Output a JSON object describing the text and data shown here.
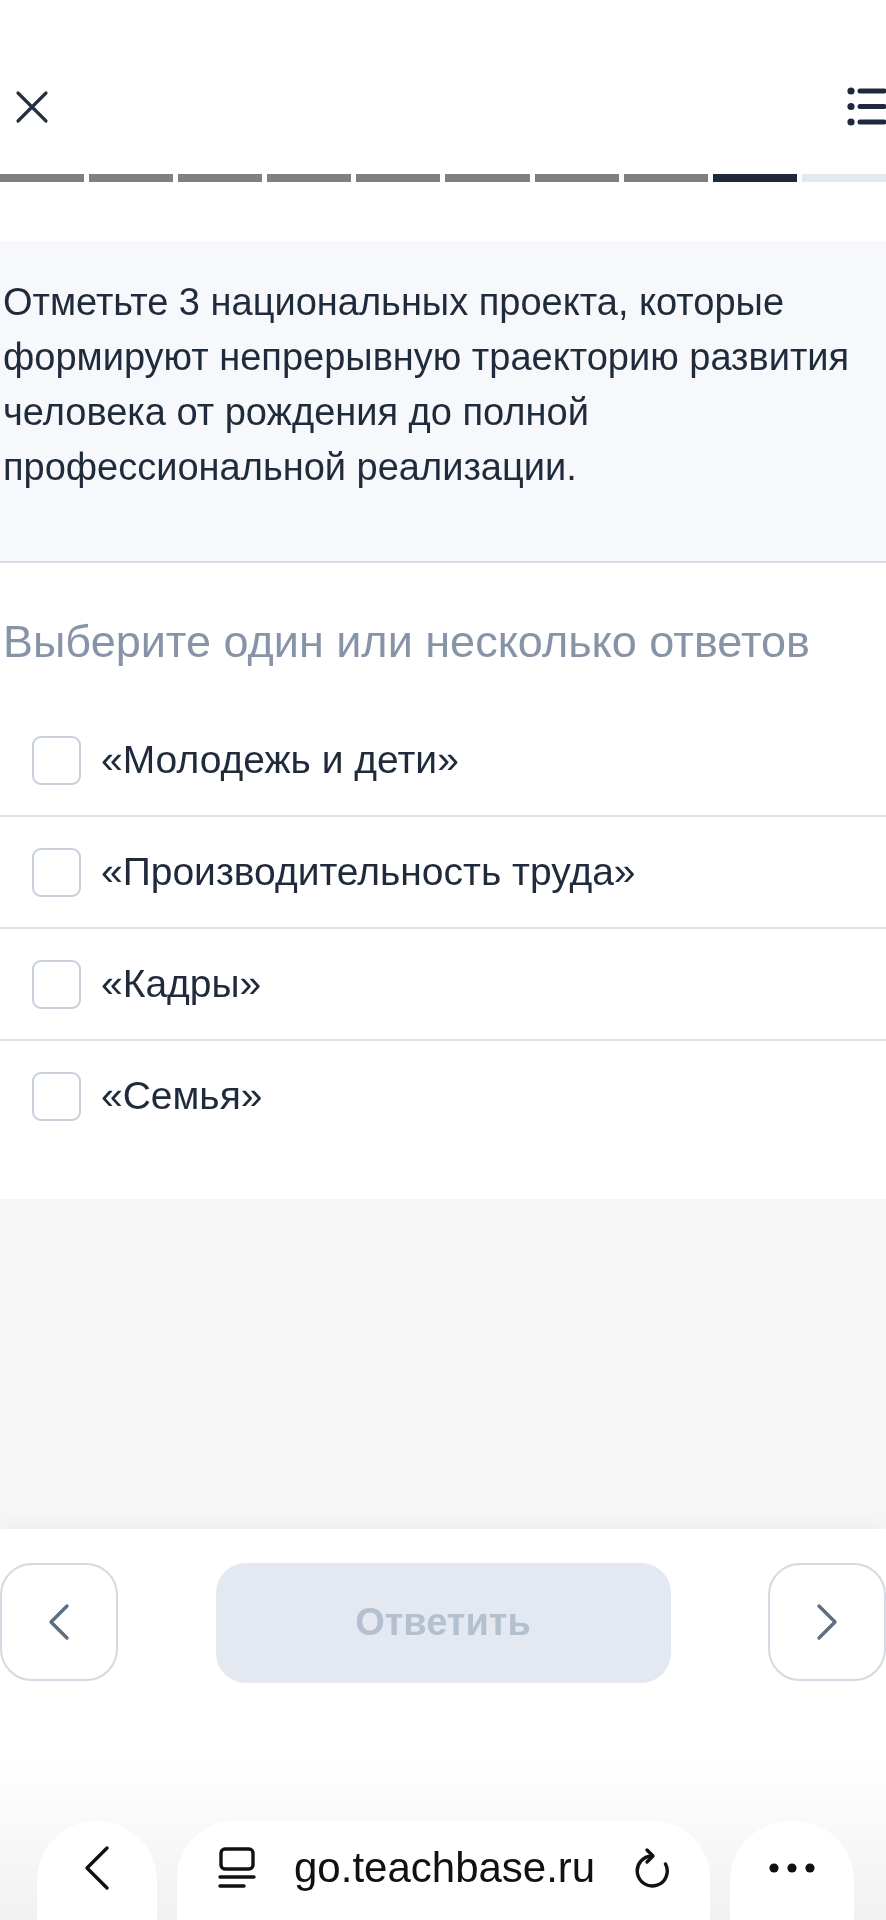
{
  "header": {
    "progress": [
      {
        "completed": true,
        "selected": false
      },
      {
        "completed": true,
        "selected": false
      },
      {
        "completed": true,
        "selected": false
      },
      {
        "completed": true,
        "selected": false
      },
      {
        "completed": true,
        "selected": false
      },
      {
        "completed": true,
        "selected": false
      },
      {
        "completed": true,
        "selected": false
      },
      {
        "completed": true,
        "selected": false
      },
      {
        "completed": false,
        "selected": true
      },
      {
        "completed": false,
        "selected": false
      }
    ]
  },
  "question": {
    "text": "Отметьте 3 национальных проекта, которые формируют непрерывную траекторию развития человека от рождения до полной профессиональной реализации."
  },
  "instruction": "Выберите один или несколько ответов",
  "options": [
    {
      "label": "«Молодежь и дети»",
      "checked": false
    },
    {
      "label": "«Производительность труда»",
      "checked": false
    },
    {
      "label": "«Кадры»",
      "checked": false
    },
    {
      "label": "«Семья»",
      "checked": false
    }
  ],
  "navigation": {
    "submit": {
      "label": "Ответить",
      "disabled": true
    }
  },
  "browser_bar": {
    "url": "go.teachbase.ru"
  }
}
